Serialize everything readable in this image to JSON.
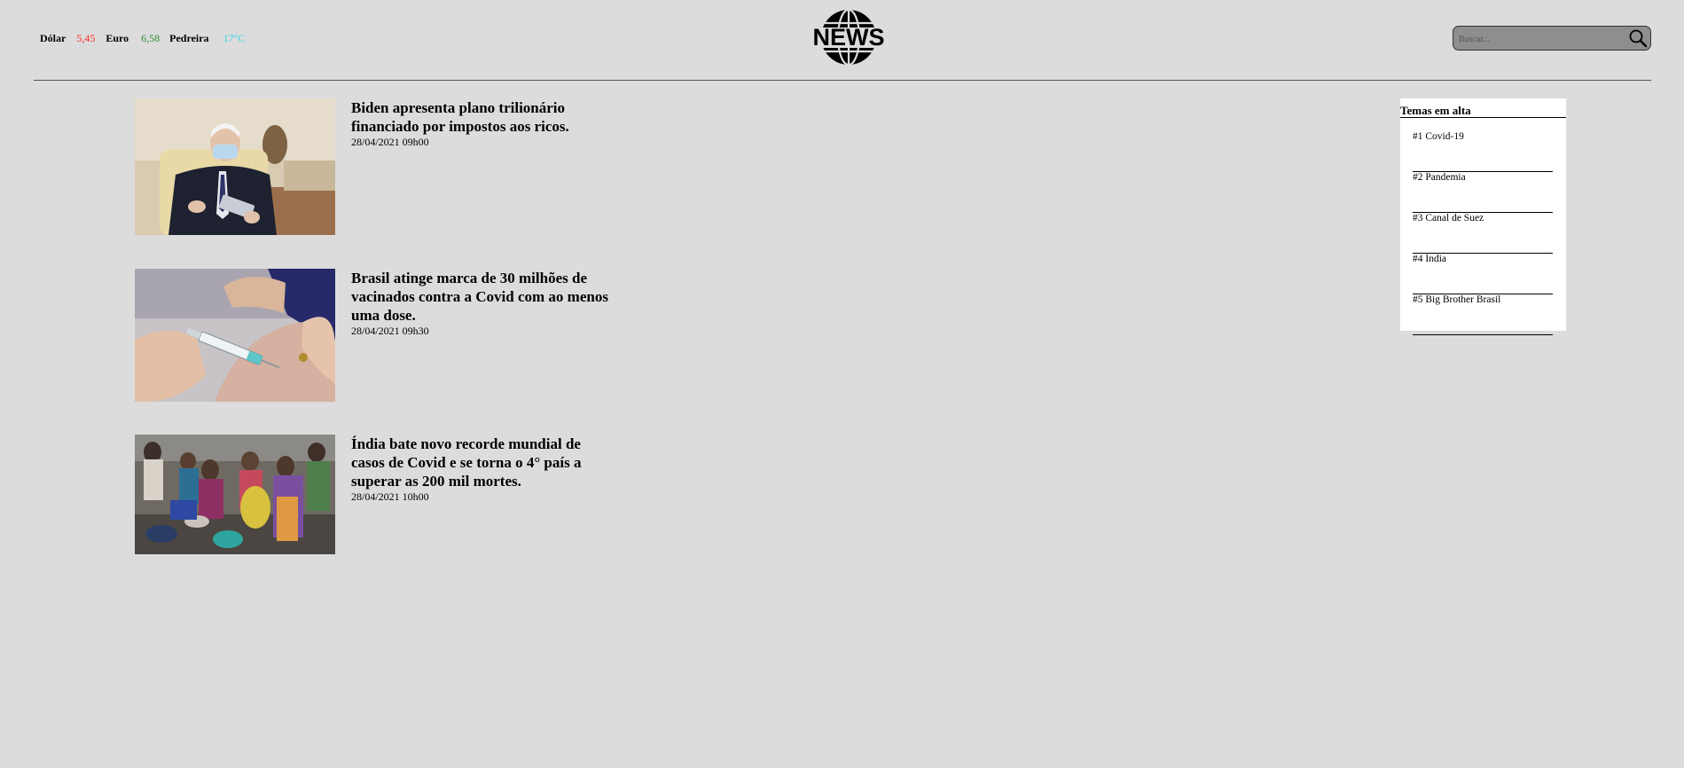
{
  "ticker": {
    "dolar_label": "Dólar",
    "dolar_value": "5,45",
    "euro_label": "Euro",
    "euro_value": "6,58",
    "city_label": "Pedreira",
    "city_temp": "17°C"
  },
  "logo": {
    "text": "NEWS",
    "icon": "globe-icon"
  },
  "search": {
    "placeholder": "Buscar...",
    "value": "",
    "button_icon": "search-icon"
  },
  "articles": [
    {
      "title": "Biden apresenta plano trilionário financiado por impostos aos ricos.",
      "date": "28/04/2021 09h00"
    },
    {
      "title": "Brasil atinge marca de 30 milhões de vacinados contra a Covid com ao menos uma dose.",
      "date": "28/04/2021 09h30"
    },
    {
      "title": "Índia bate novo recorde mundial de casos de Covid e se torna o 4° país a superar as 200 mil mortes.",
      "date": "28/04/2021 10h00"
    }
  ],
  "trending": {
    "heading": "Temas em alta",
    "items": [
      "#1 Covid-19",
      "#2 Pandemia",
      "#3 Canal de Suez",
      "#4 Índia",
      "#5 Big Brother Brasil"
    ]
  },
  "colors": {
    "background": "#dcdcdc",
    "dolar_value": "#ff2a2a",
    "euro_value": "#2f8a2f",
    "temperature": "#33d6e6",
    "search_box": "#8e8e8e",
    "trending_panel": "#ffffff"
  }
}
